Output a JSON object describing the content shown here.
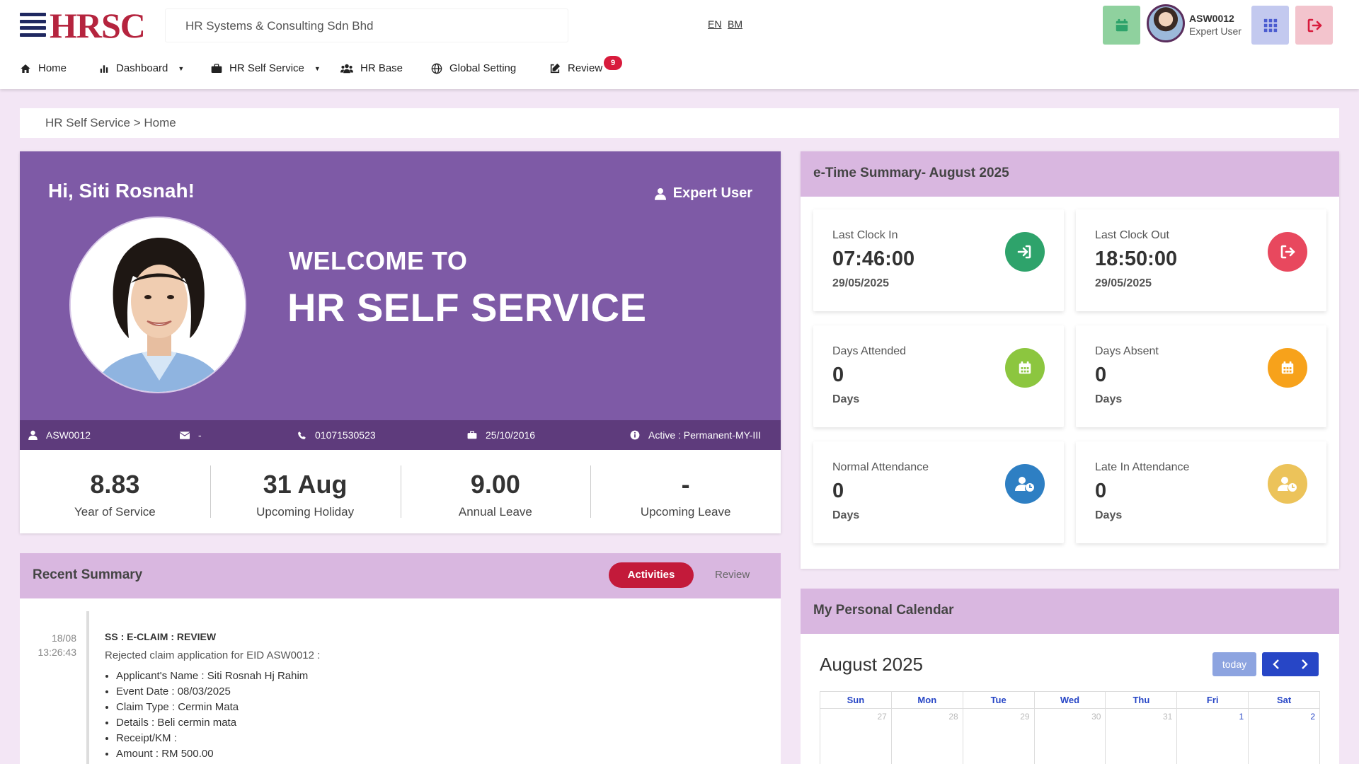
{
  "header": {
    "logo_text": "HRSC",
    "company": "HR Systems & Consulting Sdn Bhd",
    "lang_en": "EN",
    "lang_bm": "BM",
    "user_code": "ASW0012",
    "user_role": "Expert User",
    "icons": {
      "calendar": "calendar-icon",
      "apps": "grid-icon",
      "logout": "logout-icon"
    },
    "colors": {
      "brand": "#b5243e",
      "calendar_btn": "#8fd19e",
      "apps_btn": "#c3c9ef",
      "logout_btn": "#f3c4cd"
    }
  },
  "nav": {
    "items": [
      {
        "label": "Home",
        "icon": "home-icon"
      },
      {
        "label": "Dashboard",
        "icon": "bar-chart-icon"
      },
      {
        "label": "HR Self Service",
        "icon": "briefcase-icon"
      },
      {
        "label": "HR Base",
        "icon": "users-icon"
      },
      {
        "label": "Global Setting",
        "icon": "globe-icon"
      },
      {
        "label": "Review",
        "icon": "edit-icon",
        "badge": "9"
      }
    ]
  },
  "breadcrumb": "HR Self Service > Home",
  "profile": {
    "greeting": "Hi, Siti Rosnah!",
    "role": "Expert User",
    "welcome_line1": "WELCOME TO",
    "welcome_line2": "HR SELF SERVICE",
    "colors": {
      "hero": "#7e5aa6",
      "strip": "#5e3b7c"
    },
    "info": {
      "employee_id": "ASW0012",
      "email": "-",
      "phone": "01071530523",
      "join_date": "25/10/2016",
      "status": "Active : Permanent-MY-III"
    },
    "stats": [
      {
        "value": "8.83",
        "label": "Year of Service"
      },
      {
        "value": "31 Aug",
        "label": "Upcoming Holiday"
      },
      {
        "value": "9.00",
        "label": "Annual Leave"
      },
      {
        "value": "-",
        "label": "Upcoming Leave"
      }
    ]
  },
  "recent": {
    "title": "Recent Summary",
    "tab_activities": "Activities",
    "tab_review": "Review",
    "entry": {
      "date": "18/08",
      "time": "13:26:43",
      "title": "SS : E-CLAIM : REVIEW",
      "desc": "Rejected claim application for EID ASW0012 :",
      "details": [
        "Applicant's Name : Siti Rosnah Hj Rahim",
        "Event Date : 08/03/2025",
        "Claim Type : Cermin Mata",
        "Details : Beli cermin mata",
        "Receipt/KM :",
        "Amount : RM 500.00"
      ]
    }
  },
  "etime": {
    "title": "e-Time Summary- August 2025",
    "tiles": [
      {
        "label": "Last Clock In",
        "value": "07:46:00",
        "sub": "29/05/2025",
        "icon": "clock-in-icon",
        "color": "#2ea36b"
      },
      {
        "label": "Last Clock Out",
        "value": "18:50:00",
        "sub": "29/05/2025",
        "icon": "clock-out-icon",
        "color": "#e8485e"
      },
      {
        "label": "Days Attended",
        "value": "0",
        "sub": "Days",
        "icon": "calendar-icon",
        "color": "#8cc63f"
      },
      {
        "label": "Days Absent",
        "value": "0",
        "sub": "Days",
        "icon": "calendar-icon",
        "color": "#f7a21b"
      },
      {
        "label": "Normal Attendance",
        "value": "0",
        "sub": "Days",
        "icon": "user-clock-icon",
        "color": "#2e7fc3"
      },
      {
        "label": "Late In Attendance",
        "value": "0",
        "sub": "Days",
        "icon": "user-clock-icon",
        "color": "#ecc35a"
      }
    ]
  },
  "calendar": {
    "title": "My Personal Calendar",
    "month": "August 2025",
    "today_label": "today",
    "weekdays": [
      "Sun",
      "Mon",
      "Tue",
      "Wed",
      "Thu",
      "Fri",
      "Sat"
    ],
    "first_row": [
      "27",
      "28",
      "29",
      "30",
      "31",
      "1",
      "2"
    ]
  }
}
